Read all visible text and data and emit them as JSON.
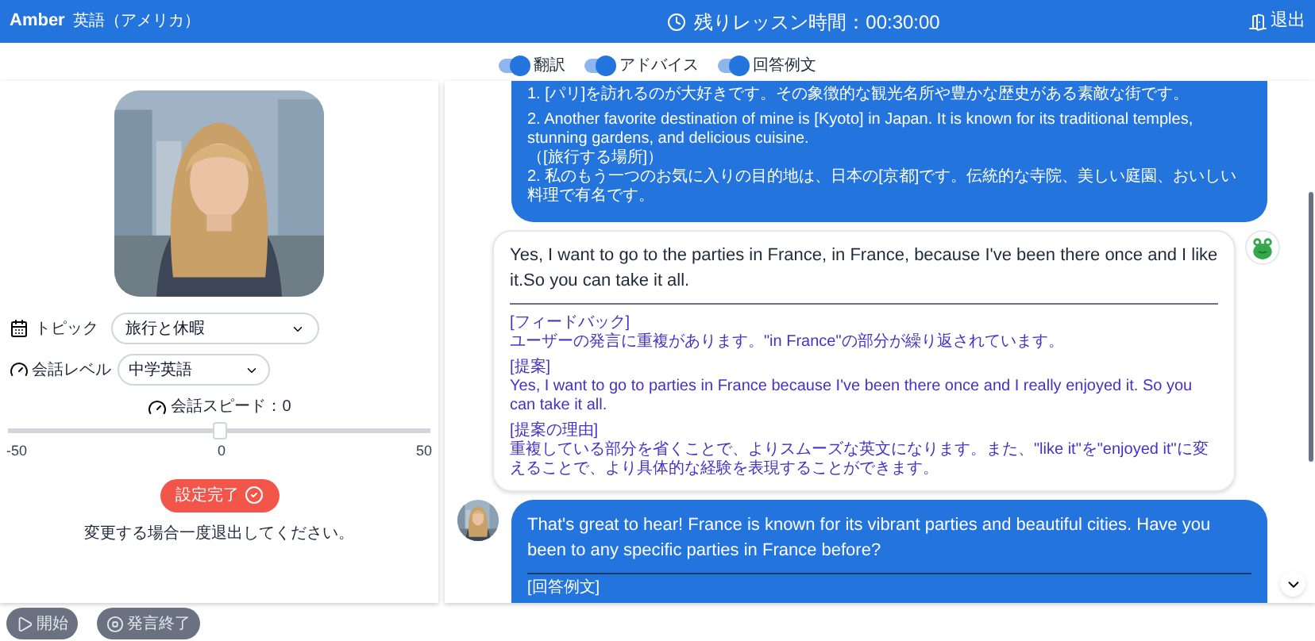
{
  "header": {
    "title": "Amber",
    "language": "英語（アメリカ）",
    "timer": "残りレッスン時間：00:30:00",
    "exit": "退出"
  },
  "toggles": [
    {
      "label": "翻訳",
      "on": true
    },
    {
      "label": "アドバイス",
      "on": true
    },
    {
      "label": "回答例文",
      "on": true
    }
  ],
  "settings": {
    "topic": {
      "label": "トピック",
      "value": "旅行と休暇"
    },
    "level": {
      "label": "会話レベル",
      "value": "中学英語"
    },
    "speed": {
      "label": "会話スピード：0",
      "level": 0.5,
      "min": "-50",
      "mid": "0",
      "max": "50"
    },
    "confirm": "設定完了",
    "note": "変更する場合一度退出してください。"
  },
  "messages": [
    {
      "kind": "bot",
      "continued": true,
      "paragraphs": [
        "1. [パリ]を訪れるのが大好きです。その象徴的な観光名所や豊かな歴史がある素敵な街です。",
        "2. Another favorite destination of mine is [Kyoto] in Japan. It is known for its traditional temples, stunning gardens, and delicious cuisine.\n（[旅行する場所]）\n2. 私のもう一つのお気に入りの目的地は、日本の[京都]です。伝統的な寺院、美しい庭園、おいしい料理で有名です。"
      ]
    },
    {
      "kind": "user",
      "text": "Yes, I want to go to the parties in France, in France, because I've been there once and I like it.So you can take it all.",
      "paragraphs": [
        "[フィードバック]\nユーザーの発言に重複があります。\"in France\"の部分が繰り返されています。",
        "[提案]\nYes, I want to go to parties in France because I've been there once and I really enjoyed it. So you can take it all.",
        "[提案の理由]\n重複している部分を省くことで、よりスムーズな英文になります。また、\"like it\"を\"enjoyed it\"に変えることで、より具体的な経験を表現することができます。"
      ]
    },
    {
      "kind": "bot",
      "continued": false,
      "text": "That's great to hear! France is known for its vibrant parties and beautiful cities. Have you been to any specific parties in France before?",
      "paragraphs": [
        "[回答例文]"
      ]
    }
  ],
  "controls": [
    {
      "label": "開始",
      "disabled": true
    },
    {
      "label": "発言終了",
      "disabled": true
    }
  ]
}
